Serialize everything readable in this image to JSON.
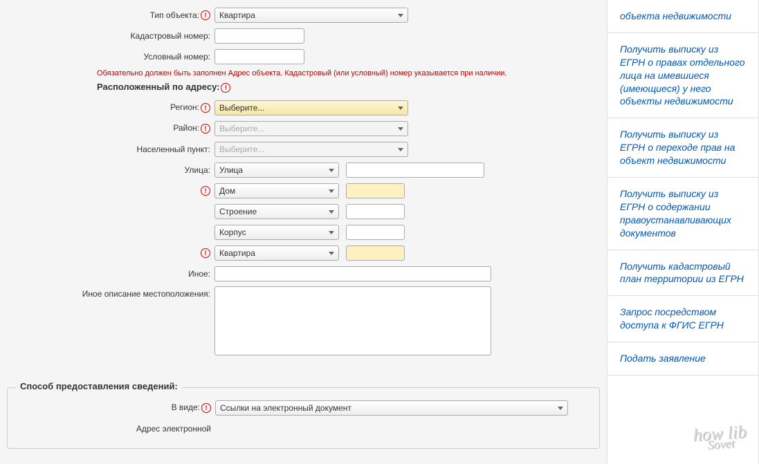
{
  "form": {
    "object_type_label": "Тип объекта:",
    "object_type_value": "Квартира",
    "cad_number_label": "Кадастровый номер:",
    "cond_number_label": "Условный номер:",
    "hint": "Обязательно должен быть заполнен Адрес объекта. Кадастровый (или условный) номер указывается при наличии.",
    "address_heading": "Расположенный по адресу:",
    "region_label": "Регион:",
    "region_value": "Выберите...",
    "district_label": "Район:",
    "district_value": "Выберите...",
    "settlement_label": "Населенный пункт:",
    "settlement_value": "Выберите...",
    "street_label": "Улица:",
    "street_value": "Улица",
    "house_value": "Дом",
    "building_value": "Строение",
    "corpus_value": "Корпус",
    "apartment_value": "Квартира",
    "other_label": "Иное:",
    "other_desc_label": "Иное описание местоположения:"
  },
  "delivery": {
    "legend": "Способ предоставления сведений:",
    "format_label": "В виде:",
    "format_value": "Ссылки на электронный документ",
    "email_label": "Адрес электронной"
  },
  "sidebar": [
    "объекта недвижимости",
    "Получить выписку из ЕГРН о правах отдельного лица на имевшиеся (имеющиеся) у него объекты недвижимости",
    "Получить выписку из ЕГРН о переходе прав на объект недвижимости",
    "Получить выписку из ЕГРН о содержании правоустанавливающих документов",
    "Получить кадастровый план территории из ЕГРН",
    "Запрос посредством доступа к ФГИС ЕГРН",
    "Подать заявление"
  ],
  "watermark": {
    "line1": "how lib",
    "line2": "Sovet"
  }
}
